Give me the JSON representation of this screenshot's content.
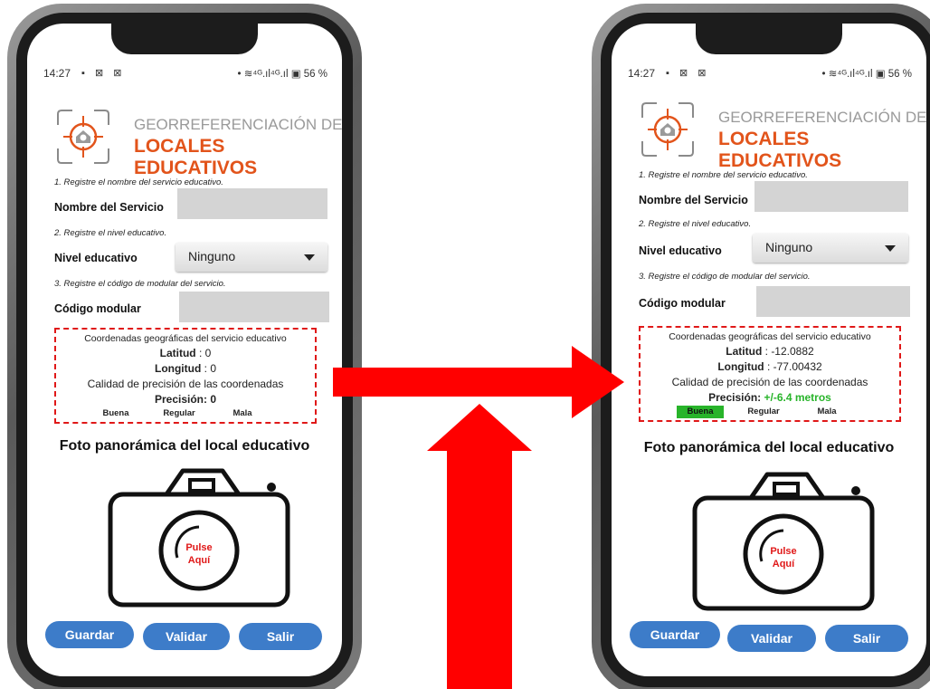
{
  "screens": [
    {
      "status": {
        "time": "14:27",
        "notifications": "▪ ⊠ ⊠",
        "system": "•  ≋⁴ᴳ.ıl⁴ᴳ.ıl  ▣ 56 %"
      },
      "brand": {
        "line1": "GEORREFERENCIACIÓN DE",
        "line2": "LOCALES EDUCATIVOS"
      },
      "step1": "1. Registre el nombre del servicio educativo.",
      "service_label": "Nombre del Servicio",
      "service_value": "",
      "step2": "2. Registre el nivel educativo.",
      "level_label": "Nivel educativo",
      "level_value": "Ninguno",
      "step3": "3. Registre el código de modular del servicio.",
      "code_label": "Código modular",
      "code_value": "",
      "coords_title": "Coordenadas geográficas del servicio educativo",
      "lat_label": "Latitud",
      "lat_sep": " : ",
      "lat_value": "0",
      "lon_label": "Longitud",
      "lon_sep": " : ",
      "lon_value": "0",
      "quality_title": "Calidad de precisión de las coordenadas",
      "precision_label": "Precisión: ",
      "precision_value": "0",
      "quality_levels": [
        "Buena",
        "Regular",
        "Mala"
      ],
      "photo_title": "Foto panorámica del local educativo",
      "camera_text": [
        "Pulse",
        "Aquí"
      ],
      "buttons": [
        "Guardar",
        "Validar",
        "Salir"
      ]
    },
    {
      "status": {
        "time": "14:27",
        "notifications": "▪ ⊠ ⊠",
        "system": "•  ≋⁴ᴳ.ıl⁴ᴳ.ıl  ▣ 56 %"
      },
      "brand": {
        "line1": "GEORREFERENCIACIÓN DE",
        "line2": "LOCALES EDUCATIVOS"
      },
      "step1": "1. Registre el nombre del servicio educativo.",
      "service_label": "Nombre del Servicio",
      "service_value": "",
      "step2": "2. Registre el nivel educativo.",
      "level_label": "Nivel educativo",
      "level_value": "Ninguno",
      "step3": "3. Registre el código de modular del servicio.",
      "code_label": "Código modular",
      "code_value": "",
      "coords_title": "Coordenadas geográficas del servicio educativo",
      "lat_label": "Latitud",
      "lat_sep": " : ",
      "lat_value": "-12.0882",
      "lon_label": "Longitud",
      "lon_sep": " : ",
      "lon_value": "-77.00432",
      "quality_title": "Calidad de precisión de las coordenadas",
      "precision_label": "Precisión: ",
      "precision_value": "+/-6.4 metros",
      "quality_levels": [
        "Buena",
        "Regular",
        "Mala"
      ],
      "photo_title": "Foto panorámica del local educativo",
      "camera_text": [
        "Pulse",
        "Aquí"
      ],
      "buttons": [
        "Guardar",
        "Validar",
        "Salir"
      ]
    }
  ],
  "colors": {
    "brand_orange": "#e2541b",
    "brand_gray": "#9a9a9a",
    "button_blue": "#3d7cc9",
    "dashed_red": "#e01818",
    "precision_good": "#28b42a",
    "arrow_red": "#ff0000"
  },
  "icons": [
    "georeference-logo-icon",
    "camera-icon",
    "arrow-right-icon",
    "arrow-up-icon",
    "dropdown-caret-icon"
  ]
}
